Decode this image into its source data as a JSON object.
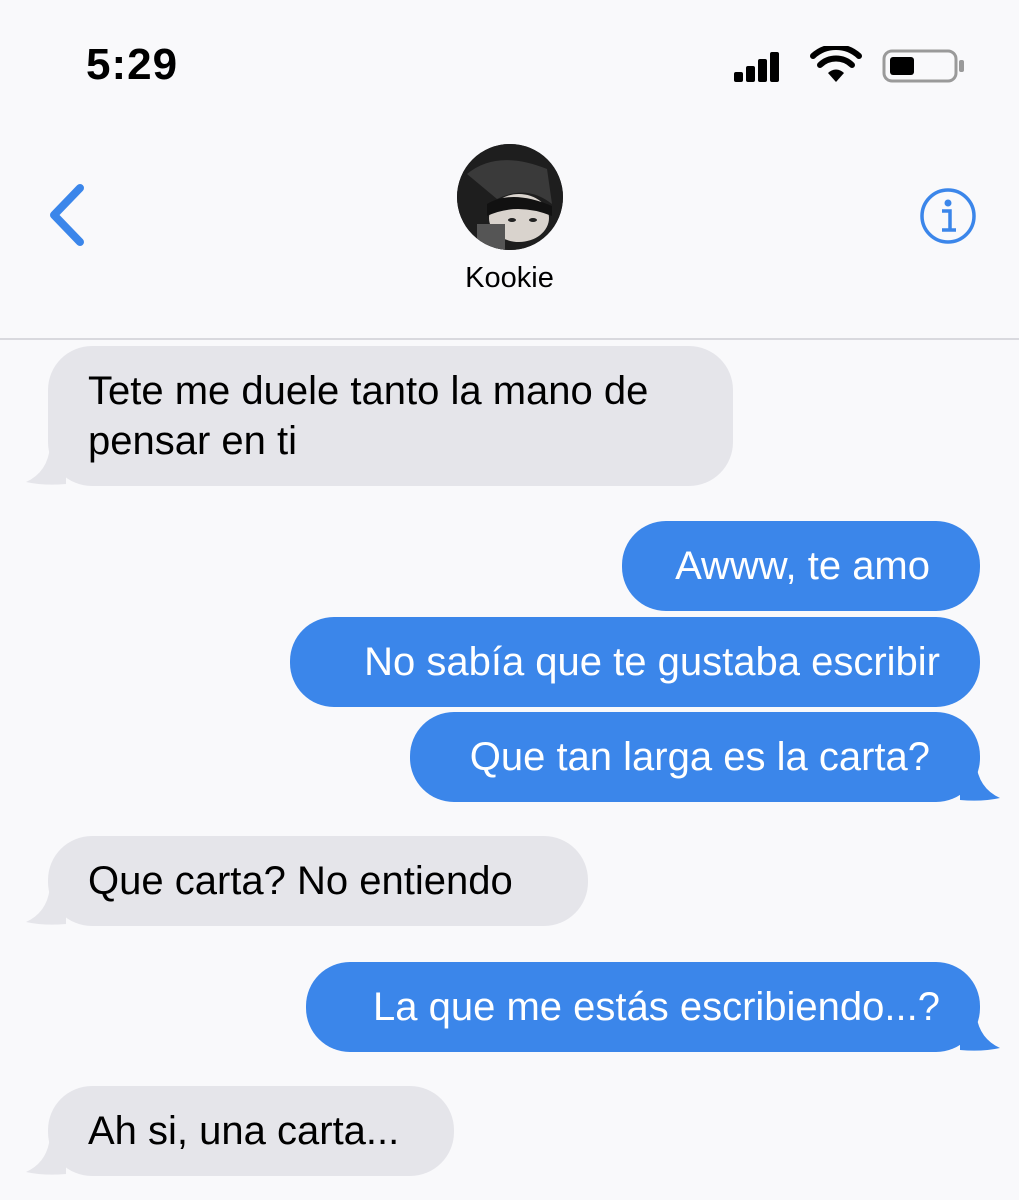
{
  "status_bar": {
    "time": "5:29"
  },
  "header": {
    "contact_name": "Kookie",
    "back_icon": "chevron-left-icon",
    "info_icon": "info-circle-icon",
    "accent_color": "#3b86ea"
  },
  "messages": [
    {
      "direction": "received",
      "lines": [
        "Tete me duele tanto la mano de",
        "pensar en ti"
      ]
    },
    {
      "direction": "sent",
      "lines": [
        "Awww, te amo"
      ]
    },
    {
      "direction": "sent",
      "lines": [
        "No sabía que te gustaba escribir"
      ]
    },
    {
      "direction": "sent",
      "lines": [
        "Que tan larga es la carta?"
      ]
    },
    {
      "direction": "received",
      "lines": [
        "Que carta? No entiendo"
      ]
    },
    {
      "direction": "sent",
      "lines": [
        "La que me estás escribiendo...?"
      ]
    },
    {
      "direction": "received",
      "lines": [
        "Ah si, una carta..."
      ]
    }
  ],
  "colors": {
    "sent_bubble": "#3b86ea",
    "received_bubble": "#e5e5ea"
  }
}
